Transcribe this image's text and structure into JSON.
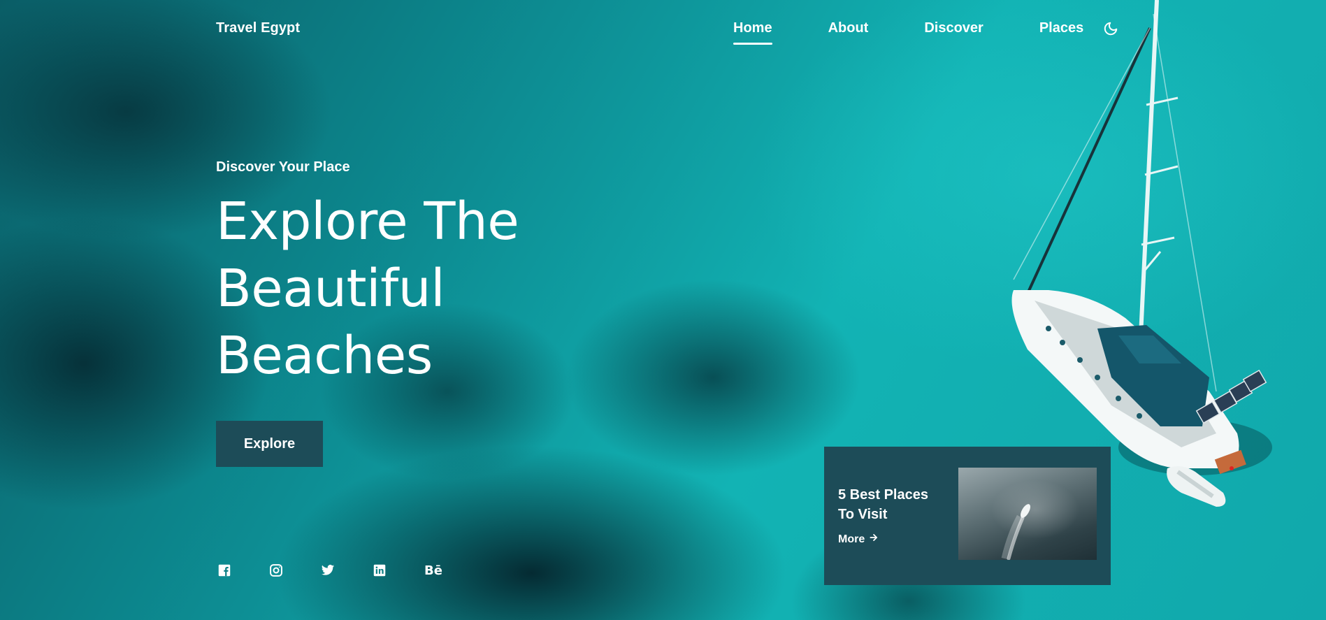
{
  "header": {
    "logo": "Travel Egypt",
    "nav": [
      {
        "label": "Home",
        "active": true
      },
      {
        "label": "About",
        "active": false
      },
      {
        "label": "Discover",
        "active": false
      },
      {
        "label": "Places",
        "active": false
      }
    ],
    "theme_icon": "moon-icon"
  },
  "hero": {
    "subtitle": "Discover Your Place",
    "title_lines": [
      "Explore The",
      "Beautiful",
      "Beaches"
    ],
    "button_label": "Explore"
  },
  "socials": [
    {
      "icon": "facebook-icon"
    },
    {
      "icon": "instagram-icon"
    },
    {
      "icon": "twitter-icon"
    },
    {
      "icon": "linkedin-icon"
    },
    {
      "icon": "behance-icon",
      "label": "Bē"
    }
  ],
  "card": {
    "title": "5 Best Places To Visit",
    "more_label": "More",
    "more_icon": "arrow-right-icon"
  },
  "colors": {
    "accent": "#1d4c58",
    "text": "#ffffff",
    "sea": "#12b3b4"
  }
}
